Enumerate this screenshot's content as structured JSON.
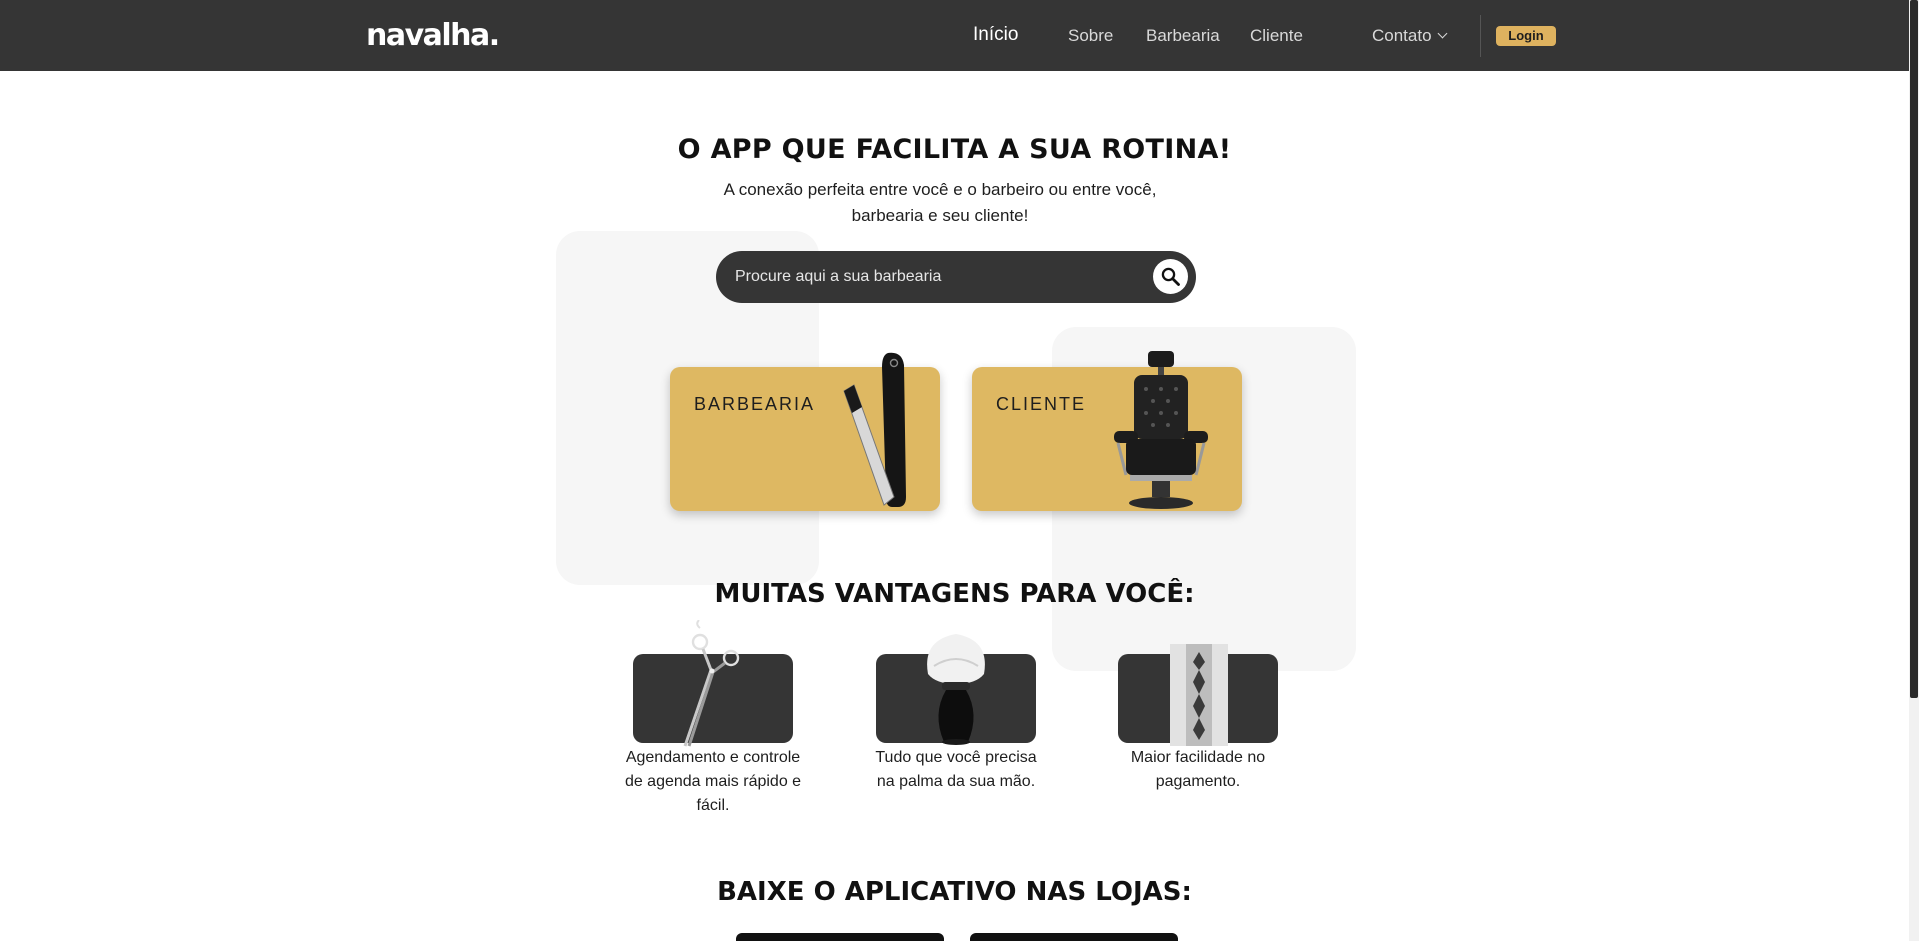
{
  "header": {
    "logo": "navalha",
    "logo_dot": ".",
    "nav": {
      "inicio": "Início",
      "sobre": "Sobre",
      "barbearia": "Barbearia",
      "cliente": "Cliente",
      "contato": "Contato"
    },
    "login": "Login"
  },
  "hero": {
    "title": "O APP QUE FACILITA A SUA ROTINA!",
    "subtitle": "A conexão perfeita entre você e o barbeiro ou entre você, barbearia e seu cliente!"
  },
  "search": {
    "placeholder": "Procure aqui a sua barbearia"
  },
  "roles": {
    "barbearia": "BARBEARIA",
    "cliente": "CLIENTE"
  },
  "advantages": {
    "title": "MUITAS VANTAGENS PARA VOCÊ:",
    "items": [
      {
        "text": "Agendamento e controle de agenda mais rápido e fácil.",
        "icon": "scissors-icon"
      },
      {
        "text": "Tudo que você precisa na palma da sua mão.",
        "icon": "shaving-brush-icon"
      },
      {
        "text": "Maior facilidade no pagamento.",
        "icon": "razor-blade-icon"
      }
    ]
  },
  "download": {
    "title": "BAIXE O APLICATIVO NAS LOJAS:"
  },
  "colors": {
    "nav_bg": "#353535",
    "accent": "#deb862",
    "login_bg": "#deb25f",
    "text": "#1e1e1e"
  }
}
